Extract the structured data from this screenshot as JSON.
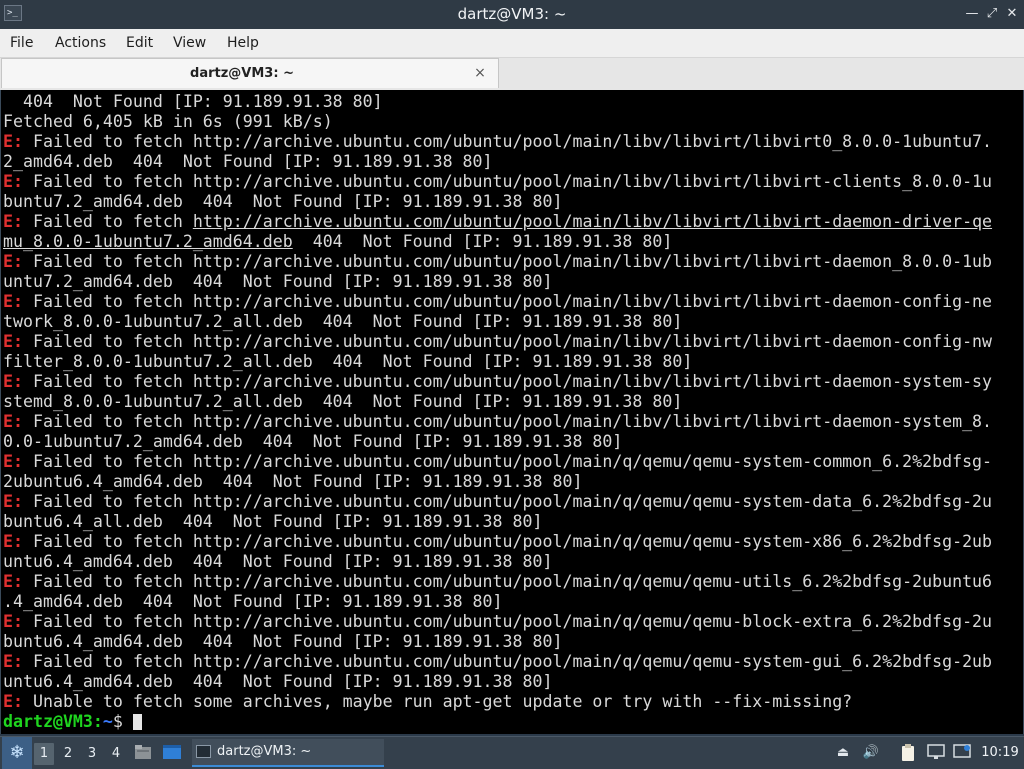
{
  "window": {
    "title": "dartz@VM3: ~",
    "controls": [
      "minimize-icon",
      "maximize-icon",
      "close-icon"
    ]
  },
  "menu": {
    "items": [
      "File",
      "Actions",
      "Edit",
      "View",
      "Help"
    ]
  },
  "tabs": [
    {
      "label": "dartz@VM3: ~",
      "close_glyph": "×"
    }
  ],
  "terminal": {
    "lines": [
      [
        {
          "t": "  404  Not Found [IP: 91.189.91.38 80]"
        }
      ],
      [
        {
          "t": "Fetched 6,405 kB in 6s (991 kB/s)"
        }
      ],
      [
        {
          "t": "E:",
          "c": "err"
        },
        {
          "t": " Failed to fetch http://archive.ubuntu.com/ubuntu/pool/main/libv/libvirt/libvirt0_8.0.0-1ubuntu7."
        }
      ],
      [
        {
          "t": "2_amd64.deb  404  Not Found [IP: 91.189.91.38 80]"
        }
      ],
      [
        {
          "t": "E:",
          "c": "err"
        },
        {
          "t": " Failed to fetch http://archive.ubuntu.com/ubuntu/pool/main/libv/libvirt/libvirt-clients_8.0.0-1u"
        }
      ],
      [
        {
          "t": "buntu7.2_amd64.deb  404  Not Found [IP: 91.189.91.38 80]"
        }
      ],
      [
        {
          "t": "E:",
          "c": "err"
        },
        {
          "t": " Failed to fetch "
        },
        {
          "t": "http://archive.ubuntu.com/ubuntu/pool/main/libv/libvirt/libvirt-daemon-driver-qe",
          "c": "ul"
        }
      ],
      [
        {
          "t": "mu_8.0.0-1ubuntu7.2_amd64.deb",
          "c": "ul"
        },
        {
          "t": "  404  Not Found [IP: 91.189.91.38 80]"
        }
      ],
      [
        {
          "t": "E:",
          "c": "err"
        },
        {
          "t": " Failed to fetch http://archive.ubuntu.com/ubuntu/pool/main/libv/libvirt/libvirt-daemon_8.0.0-1ub"
        }
      ],
      [
        {
          "t": "untu7.2_amd64.deb  404  Not Found [IP: 91.189.91.38 80]"
        }
      ],
      [
        {
          "t": "E:",
          "c": "err"
        },
        {
          "t": " Failed to fetch http://archive.ubuntu.com/ubuntu/pool/main/libv/libvirt/libvirt-daemon-config-ne"
        }
      ],
      [
        {
          "t": "twork_8.0.0-1ubuntu7.2_all.deb  404  Not Found [IP: 91.189.91.38 80]"
        }
      ],
      [
        {
          "t": "E:",
          "c": "err"
        },
        {
          "t": " Failed to fetch http://archive.ubuntu.com/ubuntu/pool/main/libv/libvirt/libvirt-daemon-config-nw"
        }
      ],
      [
        {
          "t": "filter_8.0.0-1ubuntu7.2_all.deb  404  Not Found [IP: 91.189.91.38 80]"
        }
      ],
      [
        {
          "t": "E:",
          "c": "err"
        },
        {
          "t": " Failed to fetch http://archive.ubuntu.com/ubuntu/pool/main/libv/libvirt/libvirt-daemon-system-sy"
        }
      ],
      [
        {
          "t": "stemd_8.0.0-1ubuntu7.2_all.deb  404  Not Found [IP: 91.189.91.38 80]"
        }
      ],
      [
        {
          "t": "E:",
          "c": "err"
        },
        {
          "t": " Failed to fetch http://archive.ubuntu.com/ubuntu/pool/main/libv/libvirt/libvirt-daemon-system_8."
        }
      ],
      [
        {
          "t": "0.0-1ubuntu7.2_amd64.deb  404  Not Found [IP: 91.189.91.38 80]"
        }
      ],
      [
        {
          "t": "E:",
          "c": "err"
        },
        {
          "t": " Failed to fetch http://archive.ubuntu.com/ubuntu/pool/main/q/qemu/qemu-system-common_6.2%2bdfsg-"
        }
      ],
      [
        {
          "t": "2ubuntu6.4_amd64.deb  404  Not Found [IP: 91.189.91.38 80]"
        }
      ],
      [
        {
          "t": "E:",
          "c": "err"
        },
        {
          "t": " Failed to fetch http://archive.ubuntu.com/ubuntu/pool/main/q/qemu/qemu-system-data_6.2%2bdfsg-2u"
        }
      ],
      [
        {
          "t": "buntu6.4_all.deb  404  Not Found [IP: 91.189.91.38 80]"
        }
      ],
      [
        {
          "t": "E:",
          "c": "err"
        },
        {
          "t": " Failed to fetch http://archive.ubuntu.com/ubuntu/pool/main/q/qemu/qemu-system-x86_6.2%2bdfsg-2ub"
        }
      ],
      [
        {
          "t": "untu6.4_amd64.deb  404  Not Found [IP: 91.189.91.38 80]"
        }
      ],
      [
        {
          "t": "E:",
          "c": "err"
        },
        {
          "t": " Failed to fetch http://archive.ubuntu.com/ubuntu/pool/main/q/qemu/qemu-utils_6.2%2bdfsg-2ubuntu6"
        }
      ],
      [
        {
          "t": ".4_amd64.deb  404  Not Found [IP: 91.189.91.38 80]"
        }
      ],
      [
        {
          "t": "E:",
          "c": "err"
        },
        {
          "t": " Failed to fetch http://archive.ubuntu.com/ubuntu/pool/main/q/qemu/qemu-block-extra_6.2%2bdfsg-2u"
        }
      ],
      [
        {
          "t": "buntu6.4_amd64.deb  404  Not Found [IP: 91.189.91.38 80]"
        }
      ],
      [
        {
          "t": "E:",
          "c": "err"
        },
        {
          "t": " Failed to fetch http://archive.ubuntu.com/ubuntu/pool/main/q/qemu/qemu-system-gui_6.2%2bdfsg-2ub"
        }
      ],
      [
        {
          "t": "untu6.4_amd64.deb  404  Not Found [IP: 91.189.91.38 80]"
        }
      ],
      [
        {
          "t": "E:",
          "c": "err"
        },
        {
          "t": " Unable to fetch some archives, maybe run apt-get update or try with --fix-missing?"
        }
      ]
    ],
    "prompt": {
      "user_host": "dartz@VM3",
      "sep": ":",
      "path": "~",
      "symbol": "$ "
    },
    "colors": {
      "background": "#000000",
      "text": "#d9d9d9",
      "error": "#e03030",
      "prompt_user": "#1fd51f",
      "prompt_path": "#3b7bff"
    }
  },
  "panel": {
    "start_icon": "lxqt-start-icon",
    "workspaces": [
      {
        "label": "1",
        "active": true
      },
      {
        "label": "2",
        "active": false
      },
      {
        "label": "3",
        "active": false
      },
      {
        "label": "4",
        "active": false
      }
    ],
    "quicklaunch": [
      "file-manager-icon",
      "show-desktop-icon"
    ],
    "task": {
      "label": "dartz@VM3: ~",
      "icon": "terminal-icon"
    },
    "tray": [
      "eject-icon",
      "volume-icon",
      "clipboard-icon",
      "network-icon",
      "update-icon"
    ],
    "clock": "10:19"
  }
}
